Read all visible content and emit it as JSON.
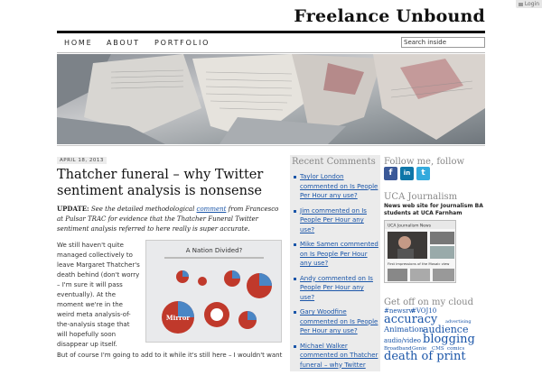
{
  "topbar": {
    "login": "Login"
  },
  "site": {
    "title": "Freelance Unbound"
  },
  "nav": {
    "items": [
      "HOME",
      "ABOUT",
      "PORTFOLIO"
    ]
  },
  "search": {
    "placeholder": "Search inside"
  },
  "post": {
    "date": "APRIL 18, 2013",
    "title": "Thatcher funeral – why Twitter sentiment analysis is nonsense",
    "update_label": "UPDATE:",
    "update_pre": "See the detailed methodological",
    "update_link": "comment",
    "update_post": "from Francesco at Pulsar TRAC for evidence that the Thatcher Funeral Twitter sentiment analysis referred to here really is super accurate.",
    "body1": "We still haven't quite managed collectively to leave Margaret Thatcher's death behind (don't worry – I'm sure it will pass eventually). At the moment we're in the weird meta analysis-of-the-analysis stage that will hopefully soon disappear up itself.",
    "body2": "But of course I'm going to add to it while it's still here – I wouldn't want",
    "infographic_title": "A Nation Divided?",
    "infographic_label": "Mirror"
  },
  "recent_comments": {
    "title": "Recent Comments",
    "items": [
      "Taylor London commented on Is People Per Hour any use?",
      "Jim commented on Is People Per Hour any use?",
      "Mike Samen commented on Is People Per Hour any use?",
      "Andy commented on Is People Per Hour any use?",
      "Gary Woodfine commented on Is People Per Hour any use?",
      "Michael Walker commented on Thatcher funeral – why Twitter"
    ]
  },
  "follow": {
    "title": "Follow me, follow",
    "icons": [
      "f",
      "in",
      "t"
    ]
  },
  "uca": {
    "title": "UCA Journalism",
    "subtitle": "News web site for Journalism BA students at UCA Farnham",
    "thumb_header": "UCA Journalism News",
    "thumb_caption": "First impressions of the Mosaic view"
  },
  "cloud": {
    "title": "Get off on my cloud",
    "tags": [
      "#newsrw",
      "#VOJ10",
      "accuracy",
      "advertising",
      "Animation",
      "audience",
      "audio/video",
      "blogging",
      "Broadband",
      "Genie",
      "CMS",
      "comics",
      "death of print"
    ]
  },
  "colors": {
    "link": "#1a55a8",
    "facebook": "#3b5998",
    "linkedin": "#0e76a8",
    "twitter": "#33aadd"
  }
}
